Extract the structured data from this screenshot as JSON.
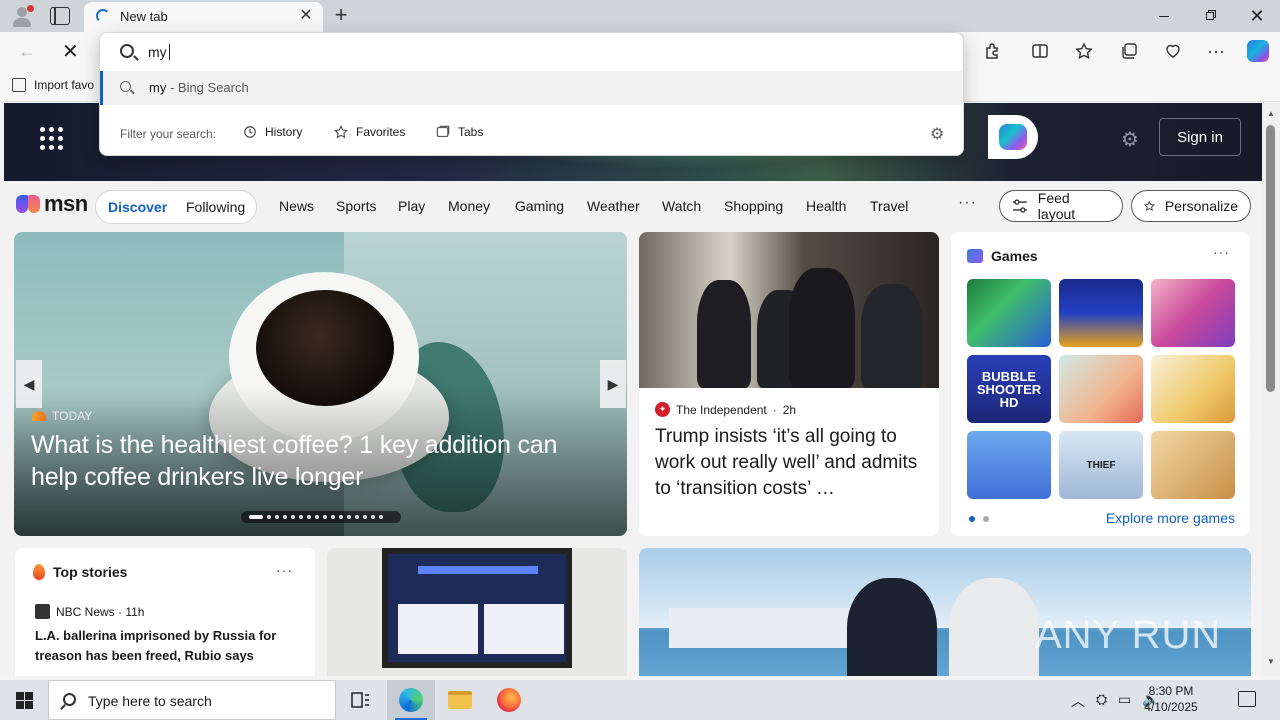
{
  "browser": {
    "tab": {
      "title": "New tab"
    },
    "favorites_bar": {
      "import_label": "Import favo"
    }
  },
  "omnibox": {
    "query": "my",
    "suggestion": {
      "text": "my",
      "source": " - Bing Search"
    },
    "filter_label": "Filter your search:",
    "filters": [
      "History",
      "Favorites",
      "Tabs"
    ]
  },
  "msn": {
    "sign_in": "Sign in",
    "logo_text": "msn",
    "feed_tabs": {
      "discover": "Discover",
      "following": "Following"
    },
    "nav": [
      "News",
      "Sports",
      "Play",
      "Money",
      "Gaming",
      "Weather",
      "Watch",
      "Shopping",
      "Health",
      "Travel"
    ],
    "nav_more": "···",
    "feed_layout": "Feed layout",
    "personalize": "Personalize",
    "hero": {
      "source": "TODAY",
      "title": "What is the healthiest coffee? 1 key addition can help coffee drinkers live longer"
    },
    "news": {
      "source": "The Independent",
      "age": "2h",
      "title": "Trump insists ‘it’s all going to work out really well’ and admits to ‘transition costs’ …"
    },
    "games": {
      "title": "Games",
      "more": "···",
      "tiles": [
        "",
        "",
        "",
        "BUBBLE SHOOTER HD",
        "",
        "",
        "",
        "THIEF",
        ""
      ],
      "explore": "Explore more games"
    },
    "top_stories": {
      "title": "Top stories",
      "more": "···",
      "source": "NBC News · 11h",
      "headline": "L.A. ballerina imprisoned by Russia for treason has been freed, Rubio says"
    },
    "watermark": "ANY RUN"
  },
  "taskbar": {
    "search_placeholder": "Type here to search",
    "time": "8:30 PM",
    "date": "4/10/2025"
  },
  "colors": {
    "accent": "#1160c6",
    "title_bar": "#cfd4d8",
    "taskbar": "#dfe3e9"
  }
}
